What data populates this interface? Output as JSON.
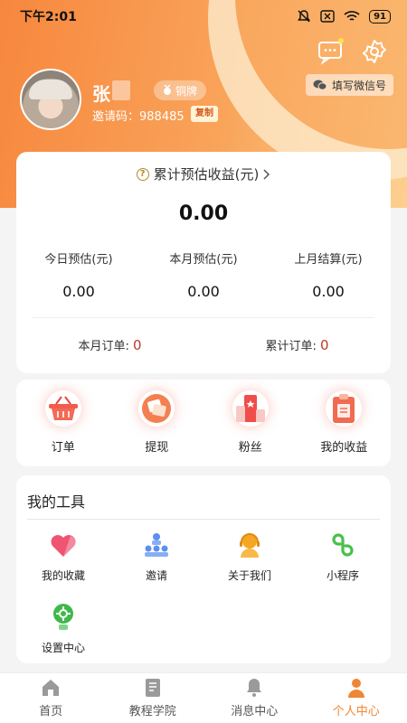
{
  "status": {
    "time": "下午2:01",
    "battery": "91"
  },
  "header": {
    "wechat_label": "填写微信号"
  },
  "user": {
    "name": "张",
    "level": "铜牌",
    "invite_code": "邀请码：988485",
    "copy_label": "复制"
  },
  "earnings": {
    "title": "累计预估收益(元)",
    "total": "0.00",
    "stats": [
      {
        "label": "今日预估(元)",
        "value": "0.00"
      },
      {
        "label": "本月预估(元)",
        "value": "0.00"
      },
      {
        "label": "上月结算(元)",
        "value": "0.00"
      }
    ],
    "month_orders_label": "本月订单:",
    "month_orders_value": "0",
    "total_orders_label": "累计订单:",
    "total_orders_value": "0"
  },
  "actions": [
    {
      "label": "订单",
      "icon": "basket-icon"
    },
    {
      "label": "提现",
      "icon": "withdraw-icon"
    },
    {
      "label": "粉丝",
      "icon": "fans-icon"
    },
    {
      "label": "我的收益",
      "icon": "income-icon"
    }
  ],
  "tools": {
    "title": "我的工具",
    "items": [
      {
        "label": "我的收藏",
        "icon": "heart-icon"
      },
      {
        "label": "邀请",
        "icon": "invite-icon"
      },
      {
        "label": "关于我们",
        "icon": "support-icon"
      },
      {
        "label": "小程序",
        "icon": "mini-program-icon"
      },
      {
        "label": "设置中心",
        "icon": "settings-bulb-icon"
      }
    ]
  },
  "tabs": [
    {
      "label": "首页",
      "icon": "home-icon"
    },
    {
      "label": "教程学院",
      "icon": "tutorial-icon"
    },
    {
      "label": "消息中心",
      "icon": "bell-icon"
    },
    {
      "label": "个人中心",
      "icon": "person-icon",
      "active": true
    }
  ],
  "colors": {
    "accent": "#f08533",
    "header_start": "#f7873e",
    "header_end": "#fcd08f"
  }
}
